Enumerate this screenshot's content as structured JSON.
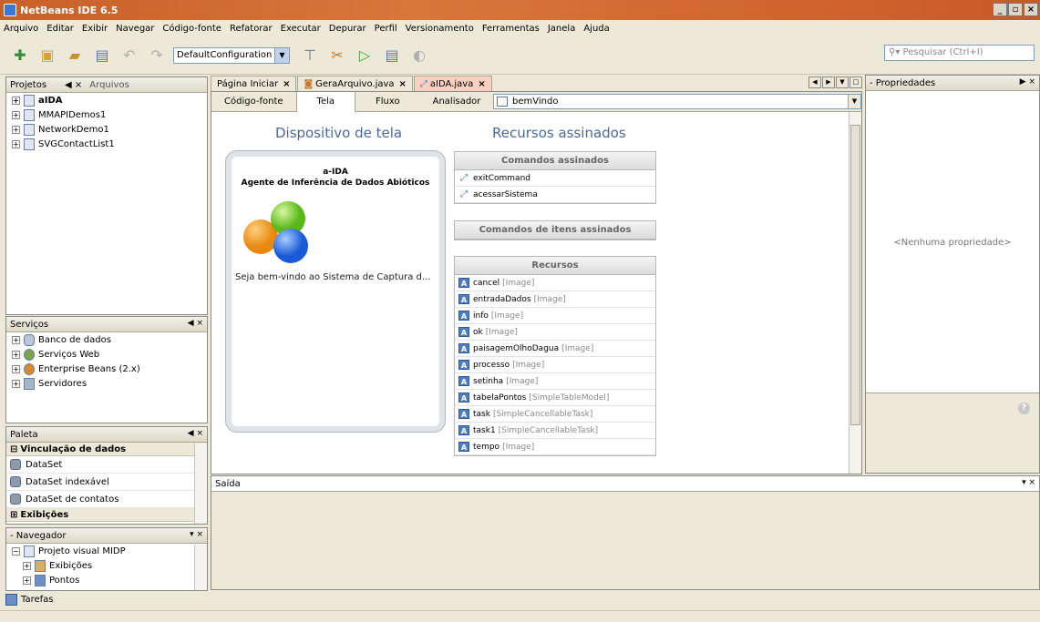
{
  "window": {
    "title": "NetBeans IDE 6.5"
  },
  "menu": [
    "Arquivo",
    "Editar",
    "Exibir",
    "Navegar",
    "Código-fonte",
    "Refatorar",
    "Executar",
    "Depurar",
    "Perfil",
    "Versionamento",
    "Ferramentas",
    "Janela",
    "Ajuda"
  ],
  "toolbar": {
    "config": "DefaultConfiguration",
    "search_placeholder": "Pesquisar (Ctrl+I)"
  },
  "projects": {
    "tab_projetos": "Projetos",
    "tab_arquivos": "Arquivos",
    "items": [
      "aIDA",
      "MMAPIDemos1",
      "NetworkDemo1",
      "SVGContactList1"
    ]
  },
  "services": {
    "title": "Serviços",
    "items": [
      "Banco de dados",
      "Serviços Web",
      "Enterprise Beans (2.x)",
      "Servidores"
    ]
  },
  "palette": {
    "title": "Paleta",
    "category1": "Vinculação de dados",
    "items": [
      "DataSet",
      "DataSet indexável",
      "DataSet de contatos"
    ],
    "category2": "Exibições"
  },
  "navigator": {
    "title": "- Navegador",
    "items": [
      "Projeto visual MIDP",
      "Exibições",
      "Pontos"
    ]
  },
  "editor": {
    "tabs": [
      "Página Iniciar",
      "GeraArquivo.java",
      "aIDA.java"
    ],
    "subtabs": [
      "Código-fonte",
      "Tela",
      "Fluxo",
      "Analisador"
    ],
    "screen": "bemVindo",
    "device_heading": "Dispositivo de tela",
    "resources_heading": "Recursos assinados",
    "device": {
      "title": "a-IDA",
      "subtitle": "Agente de Inferência de Dados Abióticos",
      "text": "Seja bem-vindo ao Sistema de Captura d..."
    },
    "commands_title": "Comandos assinados",
    "commands": [
      "exitCommand",
      "acessarSistema"
    ],
    "item_commands_title": "Comandos de itens assinados",
    "resources_title": "Recursos",
    "resources": [
      {
        "name": "cancel",
        "type": "[Image]"
      },
      {
        "name": "entradaDados",
        "type": "[Image]"
      },
      {
        "name": "info",
        "type": "[Image]"
      },
      {
        "name": "ok",
        "type": "[Image]"
      },
      {
        "name": "paisagemOlhoDagua",
        "type": "[Image]"
      },
      {
        "name": "processo",
        "type": "[Image]"
      },
      {
        "name": "setinha",
        "type": "[Image]"
      },
      {
        "name": "tabelaPontos",
        "type": "[SimpleTableModel]"
      },
      {
        "name": "task",
        "type": "[SimpleCancellableTask]"
      },
      {
        "name": "task1",
        "type": "[SimpleCancellableTask]"
      },
      {
        "name": "tempo",
        "type": "[Image]"
      }
    ]
  },
  "properties": {
    "title": "- Propriedades",
    "none": "<Nenhuma propriedade>"
  },
  "output": {
    "title": "Saída"
  },
  "status": {
    "tasks": "Tarefas"
  }
}
